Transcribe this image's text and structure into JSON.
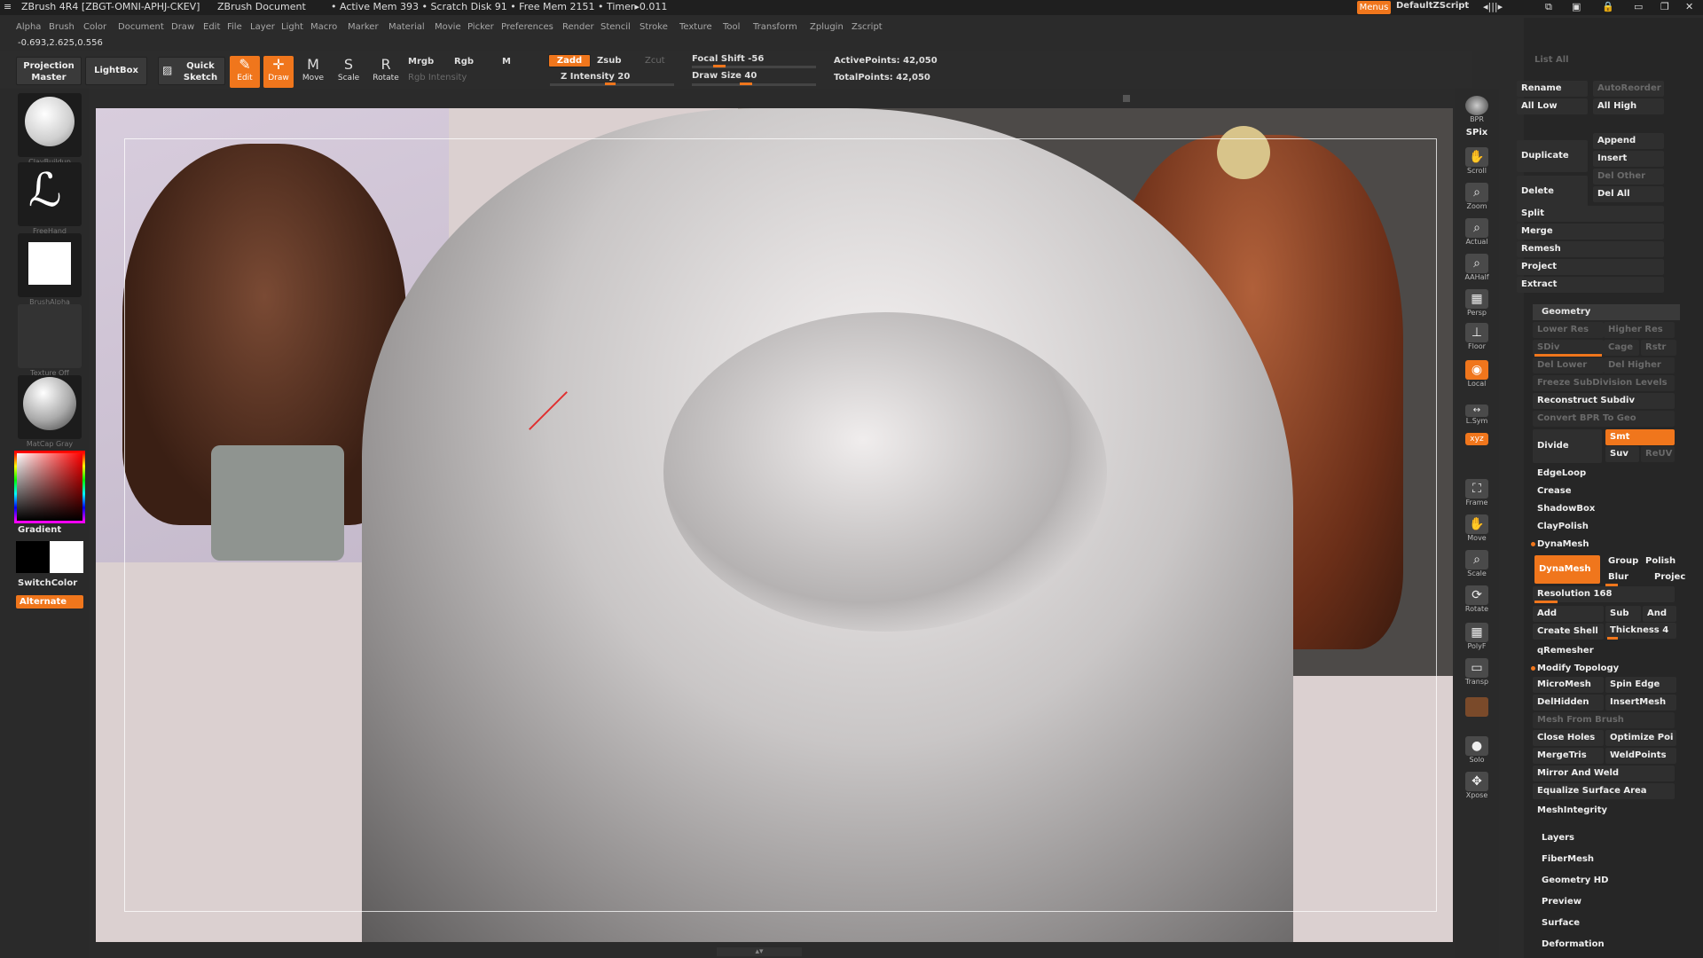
{
  "title_bar": {
    "app": "ZBrush 4R4 [ZBGT-OMNI-APHJ-CKEV]",
    "doc": "ZBrush Document",
    "stats": "• Active Mem 393 • Scratch Disk 91 • Free Mem 2151 • Timer▸0.011",
    "menus_button": "Menus",
    "script_label": "DefaultZScript"
  },
  "menu_bar": [
    "Alpha",
    "Brush",
    "Color",
    "Document",
    "Draw",
    "Edit",
    "File",
    "Layer",
    "Light",
    "Macro",
    "Marker",
    "Material",
    "Movie",
    "Picker",
    "Preferences",
    "Render",
    "Stencil",
    "Stroke",
    "Texture",
    "Tool",
    "Transform",
    "Zplugin",
    "Zscript"
  ],
  "coords": "-0.693,2.625,0.556",
  "toolbar": {
    "projection_master": "Projection Master",
    "lightbox": "LightBox",
    "quick_sketch": "Quick Sketch",
    "edit": "Edit",
    "draw": "Draw",
    "move": "Move",
    "scale": "Scale",
    "rotate": "Rotate",
    "mrgb": "Mrgb",
    "rgb": "Rgb",
    "m": "M",
    "rgb_intensity": "Rgb Intensity",
    "zadd": "Zadd",
    "zsub": "Zsub",
    "zcut": "Zcut",
    "z_intensity": "Z Intensity 20",
    "focal_shift": "Focal Shift -56",
    "draw_size": "Draw Size 40",
    "active_points": "ActivePoints: 42,050",
    "total_points": "TotalPoints: 42,050"
  },
  "left_shelf": {
    "brush": "ClayBuildup",
    "stroke": "FreeHand",
    "alpha": "BrushAlpha",
    "texture": "Texture Off",
    "material": "MatCap Gray",
    "gradient": "Gradient",
    "switch_color": "SwitchColor",
    "alternate": "Alternate"
  },
  "right_shelf": [
    "BPR",
    "SPix",
    "Scroll",
    "Zoom",
    "Actual",
    "AAHalf",
    "Persp",
    "Floor",
    "Local",
    "L.Sym",
    "Frame",
    "Move",
    "Scale",
    "Rotate",
    "PolyF",
    "Transp",
    "Solo",
    "Xpose"
  ],
  "right_panel": {
    "list_all": "List All",
    "rename": "Rename",
    "auto_reorder": "AutoReorder",
    "all_low": "All Low",
    "all_high": "All High",
    "duplicate": "Duplicate",
    "append": "Append",
    "insert": "Insert",
    "delete": "Delete",
    "del_other": "Del Other",
    "del_all": "Del All",
    "split": "Split",
    "merge": "Merge",
    "remesh": "Remesh",
    "project": "Project",
    "extract": "Extract",
    "geometry": "Geometry",
    "lower_res": "Lower Res",
    "higher_res": "Higher Res",
    "sdiv": "SDiv",
    "cage": "Cage",
    "rstr": "Rstr",
    "del_lower": "Del Lower",
    "del_higher": "Del Higher",
    "freeze_subdivision": "Freeze SubDivision Levels",
    "reconstruct_subdiv": "Reconstruct Subdiv",
    "convert_bpr": "Convert BPR To Geo",
    "divide": "Divide",
    "smt": "Smt",
    "suv": "Suv",
    "reuv": "ReUV",
    "edgeloop": "EdgeLoop",
    "crease": "Crease",
    "shadowbox": "ShadowBox",
    "claypolish": "ClayPolish",
    "dynamesh_section": "DynaMesh",
    "dynamesh_btn": "DynaMesh",
    "group": "Group",
    "polish": "Polish",
    "blur": "Blur",
    "projec": "Projec",
    "resolution": "Resolution 168",
    "add": "Add",
    "sub": "Sub",
    "and": "And",
    "create_shell": "Create Shell",
    "thickness": "Thickness 4",
    "qremesher": "qRemesher",
    "modify_topology": "Modify Topology",
    "micromesh": "MicroMesh",
    "spin_edge": "Spin Edge",
    "delhidden": "DelHidden",
    "insertmesh": "InsertMesh",
    "mesh_from_brush": "Mesh From Brush",
    "close_holes": "Close Holes",
    "optimize": "Optimize Poi",
    "mergetris": "MergeTris",
    "weldpoints": "WeldPoints",
    "mirror_weld": "Mirror And Weld",
    "equalize": "Equalize Surface Area",
    "meshintegrity": "MeshIntegrity",
    "layers": "Layers",
    "fibermesh": "FiberMesh",
    "geometry_hd": "Geometry HD",
    "preview": "Preview",
    "surface": "Surface",
    "deformation": "Deformation"
  },
  "colors": {
    "accent": "#f0761c",
    "panel": "#262626",
    "canvas": "#dbd0d0"
  }
}
